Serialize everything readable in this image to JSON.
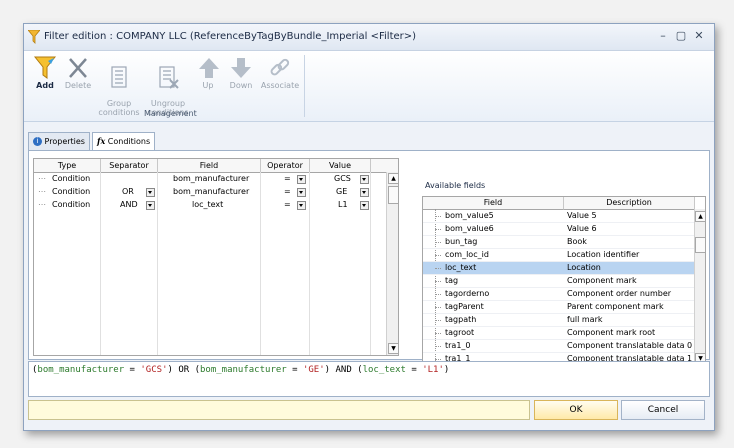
{
  "window": {
    "title": "Filter edition : COMPANY LLC (ReferenceByTagByBundle_Imperial <Filter>)",
    "minimize_icon": "minimize-icon",
    "restore_icon": "restore-icon",
    "close_icon": "close-icon"
  },
  "ribbon": {
    "buttons": [
      {
        "label": "Add",
        "icon": "filter-funnel-icon",
        "enabled": true
      },
      {
        "label": "Delete",
        "icon": "delete-x-icon",
        "enabled": false
      },
      {
        "label": "Group\nconditions",
        "icon": "group-icon",
        "enabled": false
      },
      {
        "label": "Ungroup\nconditions",
        "icon": "ungroup-icon",
        "enabled": false
      },
      {
        "label": "Up",
        "icon": "arrow-up-icon",
        "enabled": false
      },
      {
        "label": "Down",
        "icon": "arrow-down-icon",
        "enabled": false
      },
      {
        "label": "Associate",
        "icon": "chain-link-icon",
        "enabled": false
      }
    ],
    "group_label": "Management"
  },
  "tabs": [
    {
      "label": "Properties",
      "icon": "info-icon",
      "active": false
    },
    {
      "label": "Conditions",
      "icon": "fx-icon",
      "active": true
    }
  ],
  "conditions": {
    "columns": [
      "Type",
      "Separator",
      "Field",
      "Operator",
      "Value"
    ],
    "rows": [
      {
        "type": "Condition",
        "separator": "",
        "field": "bom_manufacturer",
        "operator": "=",
        "value": "GCS"
      },
      {
        "type": "Condition",
        "separator": "OR",
        "field": "bom_manufacturer",
        "operator": "=",
        "value": "GE"
      },
      {
        "type": "Condition",
        "separator": "AND",
        "field": "loc_text",
        "operator": "=",
        "value": "L1"
      }
    ]
  },
  "available_fields": {
    "label": "Available fields",
    "columns": [
      "Field",
      "Description"
    ],
    "rows": [
      {
        "field": "bom_value5",
        "description": "Value 5"
      },
      {
        "field": "bom_value6",
        "description": "Value 6"
      },
      {
        "field": "bun_tag",
        "description": "Book"
      },
      {
        "field": "com_loc_id",
        "description": "Location identifier"
      },
      {
        "field": "loc_text",
        "description": "Location",
        "selected": true
      },
      {
        "field": "tag",
        "description": "Component mark"
      },
      {
        "field": "tagorderno",
        "description": "Component order number"
      },
      {
        "field": "tagParent",
        "description": "Parent component mark"
      },
      {
        "field": "tagpath",
        "description": "full mark"
      },
      {
        "field": "tagroot",
        "description": "Component mark root"
      },
      {
        "field": "tra1_0",
        "description": "Component translatable data 0"
      },
      {
        "field": "tra1_1",
        "description": "Component translatable data 1"
      }
    ]
  },
  "expression": {
    "tokens": [
      {
        "t": "(",
        "k": "p"
      },
      {
        "t": "bom_manufacturer",
        "k": "f"
      },
      {
        "t": " = ",
        "k": "o"
      },
      {
        "t": "'GCS'",
        "k": "s"
      },
      {
        "t": ") OR (",
        "k": "p"
      },
      {
        "t": "bom_manufacturer",
        "k": "f"
      },
      {
        "t": " = ",
        "k": "o"
      },
      {
        "t": "'GE'",
        "k": "s"
      },
      {
        "t": ") AND (",
        "k": "p"
      },
      {
        "t": "loc_text",
        "k": "f"
      },
      {
        "t": " = ",
        "k": "o"
      },
      {
        "t": "'L1'",
        "k": "s"
      },
      {
        "t": ")",
        "k": "p"
      }
    ]
  },
  "status": {
    "text": ""
  },
  "buttons": {
    "ok": "OK",
    "cancel": "Cancel"
  },
  "colors": {
    "accent": "#b9d4f1",
    "ok_bg": "#ffe9a8",
    "status_bg": "#fffbdc"
  }
}
